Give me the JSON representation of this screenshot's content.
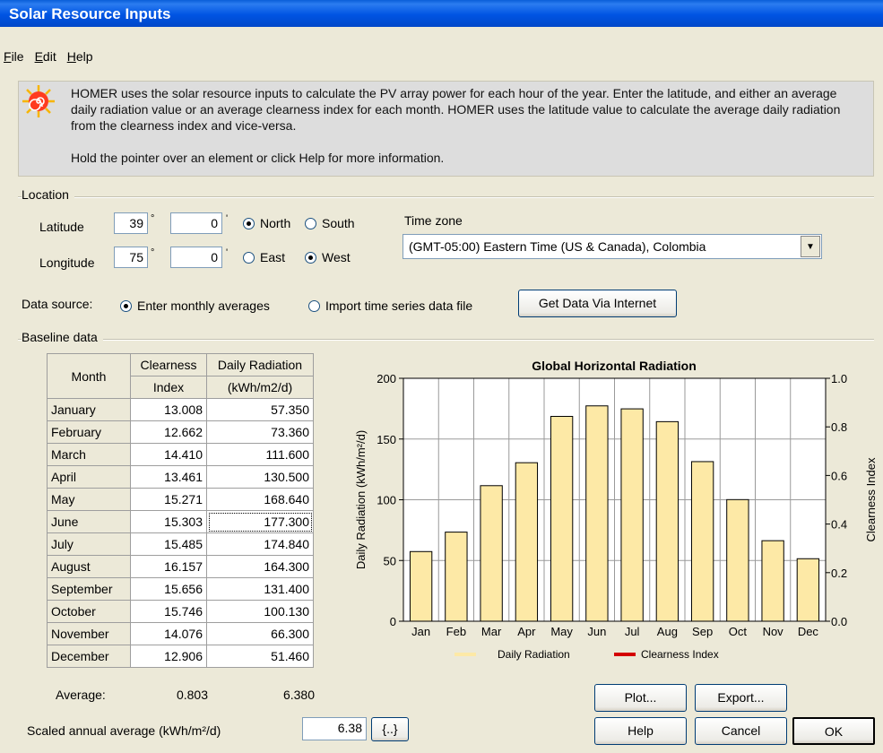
{
  "window": {
    "title": "Solar Resource Inputs"
  },
  "menu": [
    "File",
    "Edit",
    "Help"
  ],
  "info": {
    "text1": "HOMER uses the solar resource inputs to calculate the PV array power for each hour of the year. Enter the latitude, and either an average daily radiation value or an average clearness index for each month. HOMER uses the latitude value to calculate the average daily radiation from the clearness index and vice-versa.",
    "text2": "Hold the pointer over an element or click Help for more information."
  },
  "location": {
    "label": "Location",
    "latitude_label": "Latitude",
    "latitude_deg": "39",
    "latitude_min": "0",
    "longitude_label": "Longitude",
    "longitude_deg": "75",
    "longitude_min": "0",
    "deg_symbol": "°",
    "min_symbol": "'",
    "north": "North",
    "south": "South",
    "east": "East",
    "west": "West",
    "timezone_label": "Time zone",
    "timezone_value": "(GMT-05:00) Eastern Time (US & Canada), Colombia"
  },
  "datasource": {
    "label": "Data source:",
    "option1": "Enter monthly averages",
    "option2": "Import time series data file",
    "internet_button": "Get Data Via Internet"
  },
  "baseline": {
    "label": "Baseline data",
    "col_month": "Month",
    "col_clearness_1": "Clearness",
    "col_clearness_2": "Index",
    "col_radiation_1": "Daily Radiation",
    "col_radiation_2": "(kWh/m2/d)",
    "rows": [
      {
        "month": "January",
        "ci": "13.008",
        "dr": "57.350"
      },
      {
        "month": "February",
        "ci": "12.662",
        "dr": "73.360"
      },
      {
        "month": "March",
        "ci": "14.410",
        "dr": "111.600"
      },
      {
        "month": "April",
        "ci": "13.461",
        "dr": "130.500"
      },
      {
        "month": "May",
        "ci": "15.271",
        "dr": "168.640"
      },
      {
        "month": "June",
        "ci": "15.303",
        "dr": "177.300"
      },
      {
        "month": "July",
        "ci": "15.485",
        "dr": "174.840"
      },
      {
        "month": "August",
        "ci": "16.157",
        "dr": "164.300"
      },
      {
        "month": "September",
        "ci": "15.656",
        "dr": "131.400"
      },
      {
        "month": "October",
        "ci": "15.746",
        "dr": "100.130"
      },
      {
        "month": "November",
        "ci": "14.076",
        "dr": "66.300"
      },
      {
        "month": "December",
        "ci": "12.906",
        "dr": "51.460"
      }
    ],
    "average_label": "Average:",
    "average_ci": "0.803",
    "average_dr": "6.380",
    "scaled_label": "Scaled annual average (kWh/m²/d)",
    "scaled_value": "6.38",
    "scaled_button": "{..}"
  },
  "buttons": {
    "plot": "Plot...",
    "export": "Export...",
    "help": "Help",
    "cancel": "Cancel",
    "ok": "OK"
  },
  "colors": {
    "bar": "#fde9a6",
    "clearness_line": "#d40000",
    "titlebar": "#0054e3"
  },
  "chart_data": {
    "type": "bar",
    "title": "Global Horizontal Radiation",
    "categories": [
      "Jan",
      "Feb",
      "Mar",
      "Apr",
      "May",
      "Jun",
      "Jul",
      "Aug",
      "Sep",
      "Oct",
      "Nov",
      "Dec"
    ],
    "series": [
      {
        "name": "Daily Radiation",
        "values": [
          57.35,
          73.36,
          111.6,
          130.5,
          168.64,
          177.3,
          174.84,
          164.3,
          131.4,
          100.13,
          66.3,
          51.46
        ]
      },
      {
        "name": "Clearness Index",
        "values": []
      }
    ],
    "ylabel": "Daily Radiation (kWh/m²/d)",
    "y2label": "Clearness Index",
    "ylim": [
      0,
      200
    ],
    "y2lim": [
      0,
      1.0
    ],
    "yticks": [
      "0",
      "50",
      "100",
      "150",
      "200"
    ],
    "y2ticks": [
      "0.0",
      "0.2",
      "0.4",
      "0.6",
      "0.8",
      "1.0"
    ],
    "grid": true,
    "legend": "bottom"
  }
}
